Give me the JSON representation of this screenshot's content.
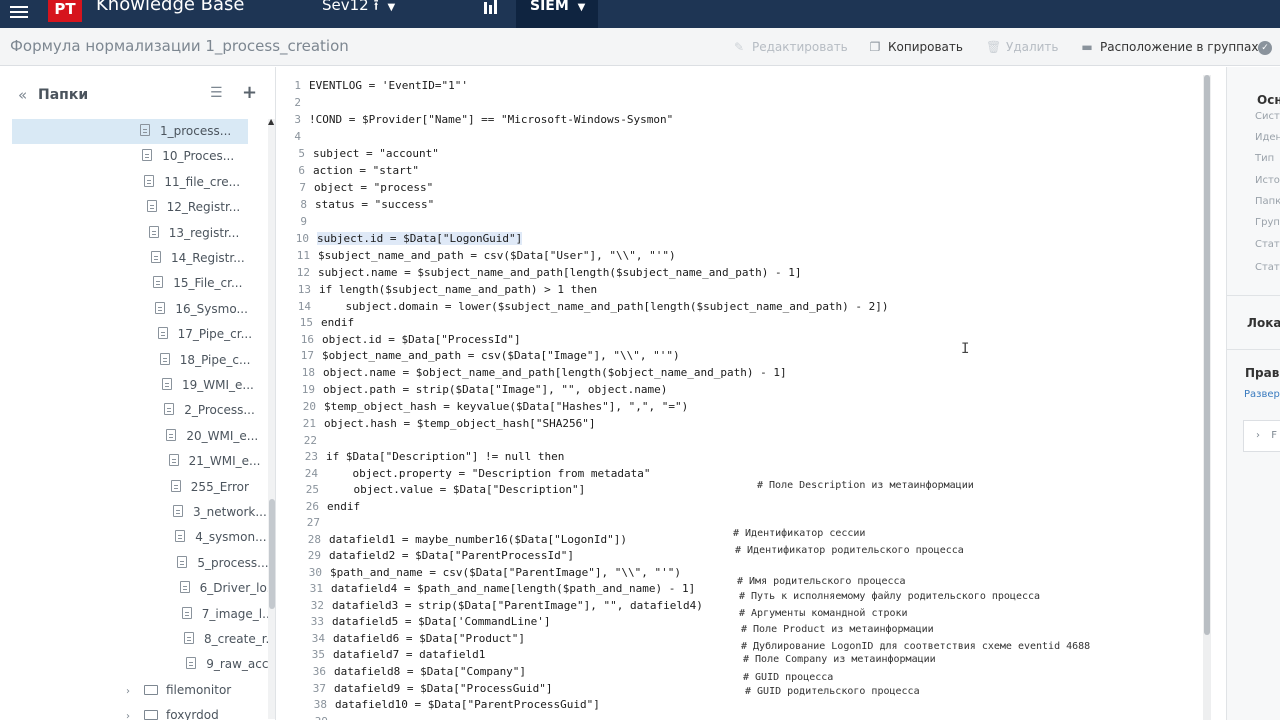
{
  "topbar": {
    "logo": "PT",
    "app_title": "Knowledge Base",
    "environment": "Sev12",
    "active_module": "SIEM"
  },
  "header": {
    "page_title": "Формула нормализации 1_process_creation",
    "actions": {
      "edit": "Редактировать",
      "copy": "Копировать",
      "delete": "Удалить",
      "location": "Расположение в группах"
    }
  },
  "sidebar": {
    "title": "Папки",
    "items": [
      {
        "label": "1_process...",
        "type": "file",
        "selected": true
      },
      {
        "label": "10_Proces...",
        "type": "file"
      },
      {
        "label": "11_file_cre...",
        "type": "file"
      },
      {
        "label": "12_Registr...",
        "type": "file"
      },
      {
        "label": "13_registr...",
        "type": "file"
      },
      {
        "label": "14_Registr...",
        "type": "file"
      },
      {
        "label": "15_File_cr...",
        "type": "file"
      },
      {
        "label": "16_Sysmo...",
        "type": "file"
      },
      {
        "label": "17_Pipe_cr...",
        "type": "file"
      },
      {
        "label": "18_Pipe_c...",
        "type": "file"
      },
      {
        "label": "19_WMI_e...",
        "type": "file"
      },
      {
        "label": "2_Process...",
        "type": "file"
      },
      {
        "label": "20_WMI_e...",
        "type": "file"
      },
      {
        "label": "21_WMI_e...",
        "type": "file"
      },
      {
        "label": "255_Error",
        "type": "file"
      },
      {
        "label": "3_network...",
        "type": "file"
      },
      {
        "label": "4_sysmon...",
        "type": "file"
      },
      {
        "label": "5_process...",
        "type": "file"
      },
      {
        "label": "6_Driver_lo...",
        "type": "file"
      },
      {
        "label": "7_image_l...",
        "type": "file"
      },
      {
        "label": "8_create_r...",
        "type": "file"
      },
      {
        "label": "9_raw_acc...",
        "type": "file"
      },
      {
        "label": "filemonitor",
        "type": "folder"
      },
      {
        "label": "foxyrdod",
        "type": "folder"
      }
    ]
  },
  "editor": {
    "lines": [
      {
        "n": "1",
        "code": "EVENTLOG = 'EventID=\"1\"'"
      },
      {
        "n": "2",
        "code": ""
      },
      {
        "n": "3",
        "code": "!COND = $Provider[\"Name\"] == \"Microsoft-Windows-Sysmon\""
      },
      {
        "n": "4",
        "code": ""
      },
      {
        "n": "5",
        "code": "subject = \"account\""
      },
      {
        "n": "6",
        "code": "action = \"start\""
      },
      {
        "n": "7",
        "code": "object = \"process\""
      },
      {
        "n": "8",
        "code": "status = \"success\""
      },
      {
        "n": "9",
        "code": ""
      },
      {
        "n": "10",
        "code": "subject.id = $Data[\"LogonGuid\"]"
      },
      {
        "n": "11",
        "code": "$subject_name_and_path = csv($Data[\"User\"], \"\\\\\", \"'\")"
      },
      {
        "n": "12",
        "code": "subject.name = $subject_name_and_path[length($subject_name_and_path) - 1]"
      },
      {
        "n": "13",
        "code": "if length($subject_name_and_path) > 1 then"
      },
      {
        "n": "14",
        "code": "    subject.domain = lower($subject_name_and_path[length($subject_name_and_path) - 2])"
      },
      {
        "n": "15",
        "code": "endif"
      },
      {
        "n": "16",
        "code": "object.id = $Data[\"ProcessId\"]"
      },
      {
        "n": "17",
        "code": "$object_name_and_path = csv($Data[\"Image\"], \"\\\\\", \"'\")"
      },
      {
        "n": "18",
        "code": "object.name = $object_name_and_path[length($object_name_and_path) - 1]"
      },
      {
        "n": "19",
        "code": "object.path = strip($Data[\"Image\"], \"\", object.name)"
      },
      {
        "n": "20",
        "code": "$temp_object_hash = keyvalue($Data[\"Hashes\"], \",\", \"=\")"
      },
      {
        "n": "21",
        "code": "object.hash = $temp_object_hash[\"SHA256\"]"
      },
      {
        "n": "22",
        "code": ""
      },
      {
        "n": "23",
        "code": "if $Data[\"Description\"] != null then"
      },
      {
        "n": "24",
        "code": "    object.property = \"Description from metadata\""
      },
      {
        "n": "25",
        "code": "    object.value = $Data[\"Description\"]"
      },
      {
        "n": "26",
        "code": "endif"
      },
      {
        "n": "27",
        "code": ""
      },
      {
        "n": "28",
        "code": "datafield1 = maybe_number16($Data[\"LogonId\"])"
      },
      {
        "n": "29",
        "code": "datafield2 = $Data[\"ParentProcessId\"]"
      },
      {
        "n": "30",
        "code": "$path_and_name = csv($Data[\"ParentImage\"], \"\\\\\", \"'\")"
      },
      {
        "n": "31",
        "code": "datafield4 = $path_and_name[length($path_and_name) - 1]"
      },
      {
        "n": "32",
        "code": "datafield3 = strip($Data[\"ParentImage\"], \"\", datafield4)"
      },
      {
        "n": "33",
        "code": "datafield5 = $Data['CommandLine']"
      },
      {
        "n": "34",
        "code": "datafield6 = $Data[\"Product\"]"
      },
      {
        "n": "35",
        "code": "datafield7 = datafield1"
      },
      {
        "n": "36",
        "code": "datafield8 = $Data[\"Company\"]"
      },
      {
        "n": "37",
        "code": "datafield9 = $Data[\"ProcessGuid\"]"
      },
      {
        "n": "38",
        "code": "datafield10 = $Data[\"ParentProcessGuid\"]"
      },
      {
        "n": "39",
        "code": ""
      }
    ],
    "comments": [
      "# Поле Description из метаинформации",
      "# Идентификатор сессии",
      "# Идентификатор родительского процесса",
      "# Имя родительского процесса",
      "# Путь к исполняемому файлу родительского процесса",
      "# Аргументы командной строки",
      "# Поле Product из метаинформации",
      "# Дублирование LogonID для соответствия схеме eventid 4688",
      "# Поле Company из метаинформации",
      "# GUID процесса",
      "# GUID родительского процесса"
    ]
  },
  "properties": {
    "section_main": "Осно",
    "fields": [
      "Систе",
      "Иден",
      "Тип",
      "Источ",
      "Папка",
      "Групп",
      "Статус",
      "Статус"
    ],
    "section_local": "Локал",
    "section_rules": "Прави",
    "rules_link": "Развер",
    "box_label": "F"
  }
}
